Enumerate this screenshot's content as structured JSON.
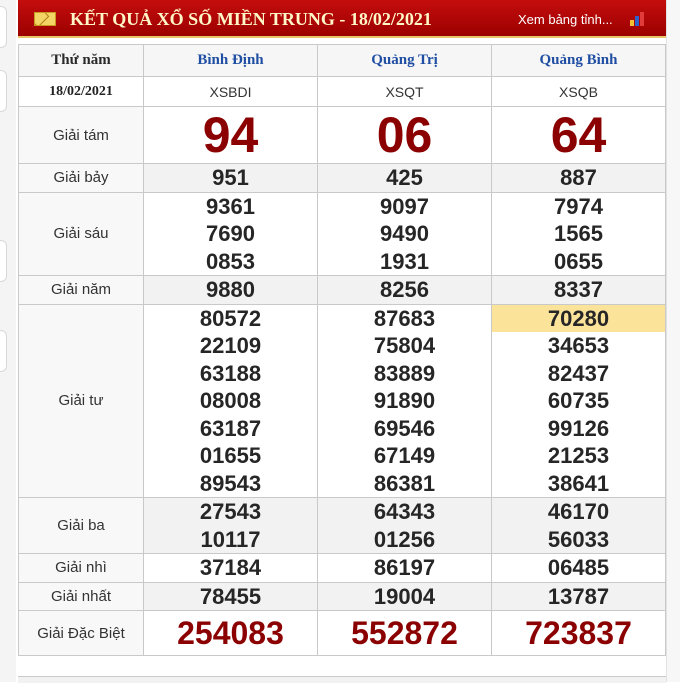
{
  "header": {
    "title": "KẾT QUẢ XỔ SỐ MIỀN TRUNG - 18/02/2021",
    "link": "Xem bảng tỉnh...",
    "mail_icon": "mail-icon",
    "chart_icon": "bar-chart-icon"
  },
  "table": {
    "day_label": "Thứ năm",
    "date": "18/02/2021",
    "provinces": [
      "Bình Định",
      "Quảng Trị",
      "Quảng Bình"
    ],
    "codes": [
      "XSBDI",
      "XSQT",
      "XSQB"
    ],
    "prizes": [
      {
        "label": "Giải tám",
        "values": [
          [
            "94"
          ],
          [
            "06"
          ],
          [
            "64"
          ]
        ]
      },
      {
        "label": "Giải bảy",
        "values": [
          [
            "951"
          ],
          [
            "425"
          ],
          [
            "887"
          ]
        ]
      },
      {
        "label": "Giải sáu",
        "values": [
          [
            "9361",
            "7690",
            "0853"
          ],
          [
            "9097",
            "9490",
            "1931"
          ],
          [
            "7974",
            "1565",
            "0655"
          ]
        ]
      },
      {
        "label": "Giải năm",
        "values": [
          [
            "9880"
          ],
          [
            "8256"
          ],
          [
            "8337"
          ]
        ]
      },
      {
        "label": "Giải tư",
        "values": [
          [
            "80572",
            "22109",
            "63188",
            "08008",
            "63187",
            "01655",
            "89543"
          ],
          [
            "87683",
            "75804",
            "83889",
            "91890",
            "69546",
            "67149",
            "86381"
          ],
          [
            "70280",
            "34653",
            "82437",
            "60735",
            "99126",
            "21253",
            "38641"
          ]
        ]
      },
      {
        "label": "Giải ba",
        "values": [
          [
            "27543",
            "10117"
          ],
          [
            "64343",
            "01256"
          ],
          [
            "46170",
            "56033"
          ]
        ]
      },
      {
        "label": "Giải nhì",
        "values": [
          [
            "37184"
          ],
          [
            "86197"
          ],
          [
            "06485"
          ]
        ]
      },
      {
        "label": "Giải nhất",
        "values": [
          [
            "78455"
          ],
          [
            "19004"
          ],
          [
            "13787"
          ]
        ]
      },
      {
        "label": "Giải Đặc Biệt",
        "values": [
          [
            "254083"
          ],
          [
            "552872"
          ],
          [
            "723837"
          ]
        ]
      }
    ],
    "highlight_color": "#fbe39a",
    "accent_red": "#8b0000",
    "header_blue": "#1f4ea3"
  }
}
